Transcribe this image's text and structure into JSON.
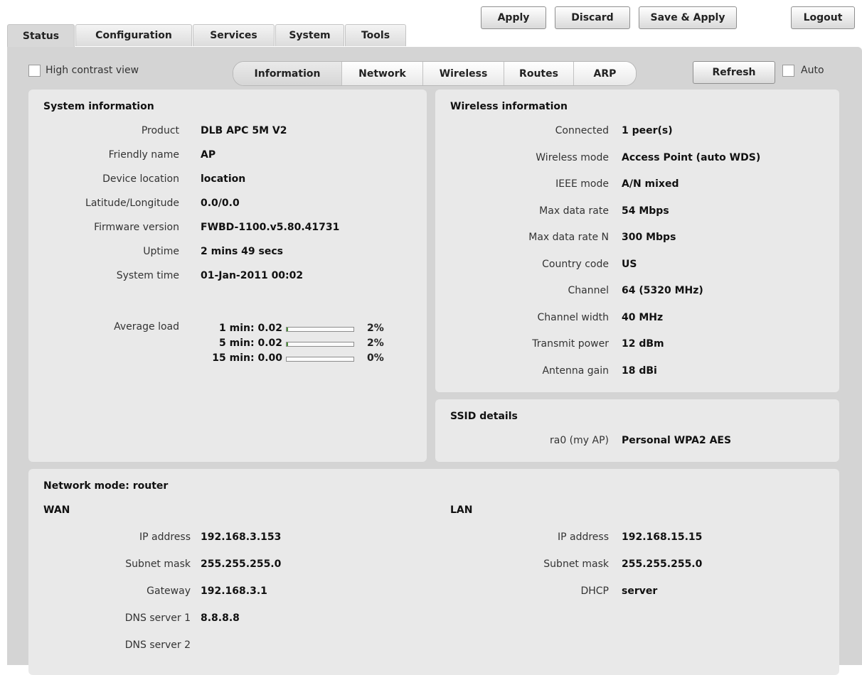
{
  "tabs": [
    "Status",
    "Configuration",
    "Services",
    "System",
    "Tools"
  ],
  "top_buttons": {
    "apply": "Apply",
    "discard": "Discard",
    "save_apply": "Save & Apply",
    "logout": "Logout"
  },
  "high_contrast_label": "High contrast view",
  "subtabs": [
    "Information",
    "Network",
    "Wireless",
    "Routes",
    "ARP"
  ],
  "refresh_label": "Refresh",
  "auto_label": "Auto",
  "system_info": {
    "title": "System information",
    "rows": [
      {
        "label": "Product",
        "value": "DLB APC 5M V2"
      },
      {
        "label": "Friendly name",
        "value": "AP"
      },
      {
        "label": "Device location",
        "value": "location"
      },
      {
        "label": "Latitude/Longitude",
        "value": "0.0/0.0"
      },
      {
        "label": "Firmware version",
        "value": "FWBD-1100.v5.80.41731"
      },
      {
        "label": "Uptime",
        "value": "2 mins 49 secs"
      },
      {
        "label": "System time",
        "value": "01-Jan-2011 00:02"
      }
    ],
    "avg_load_label": "Average load",
    "loads": [
      {
        "label": "1 min: 0.02",
        "percent": "2%",
        "fraction": 0.02
      },
      {
        "label": "5 min: 0.02",
        "percent": "2%",
        "fraction": 0.02
      },
      {
        "label": "15 min: 0.00",
        "percent": "0%",
        "fraction": 0.0
      }
    ]
  },
  "wireless_info": {
    "title": "Wireless information",
    "rows": [
      {
        "label": "Connected",
        "value": "1 peer(s)"
      },
      {
        "label": "Wireless mode",
        "value": "Access Point (auto WDS)"
      },
      {
        "label": "IEEE mode",
        "value": "A/N mixed"
      },
      {
        "label": "Max data rate",
        "value": "54 Mbps"
      },
      {
        "label": "Max data rate N",
        "value": "300 Mbps"
      },
      {
        "label": "Country code",
        "value": "US"
      },
      {
        "label": "Channel",
        "value": "64 (5320 MHz)"
      },
      {
        "label": "Channel width",
        "value": "40 MHz"
      },
      {
        "label": "Transmit power",
        "value": "12 dBm"
      },
      {
        "label": "Antenna gain",
        "value": "18 dBi"
      }
    ]
  },
  "ssid": {
    "title": "SSID details",
    "rows": [
      {
        "label": "ra0 (my AP)",
        "value": "Personal WPA2 AES"
      }
    ]
  },
  "network": {
    "title": "Network mode: router",
    "wan_title": "WAN",
    "wan_rows": [
      {
        "label": "IP address",
        "value": "192.168.3.153"
      },
      {
        "label": "Subnet mask",
        "value": "255.255.255.0"
      },
      {
        "label": "Gateway",
        "value": "192.168.3.1"
      },
      {
        "label": "DNS server 1",
        "value": "8.8.8.8"
      },
      {
        "label": "DNS server 2",
        "value": ""
      }
    ],
    "lan_title": "LAN",
    "lan_rows": [
      {
        "label": "IP address",
        "value": "192.168.15.15"
      },
      {
        "label": "Subnet mask",
        "value": "255.255.255.0"
      },
      {
        "label": "DHCP",
        "value": "server"
      }
    ]
  }
}
